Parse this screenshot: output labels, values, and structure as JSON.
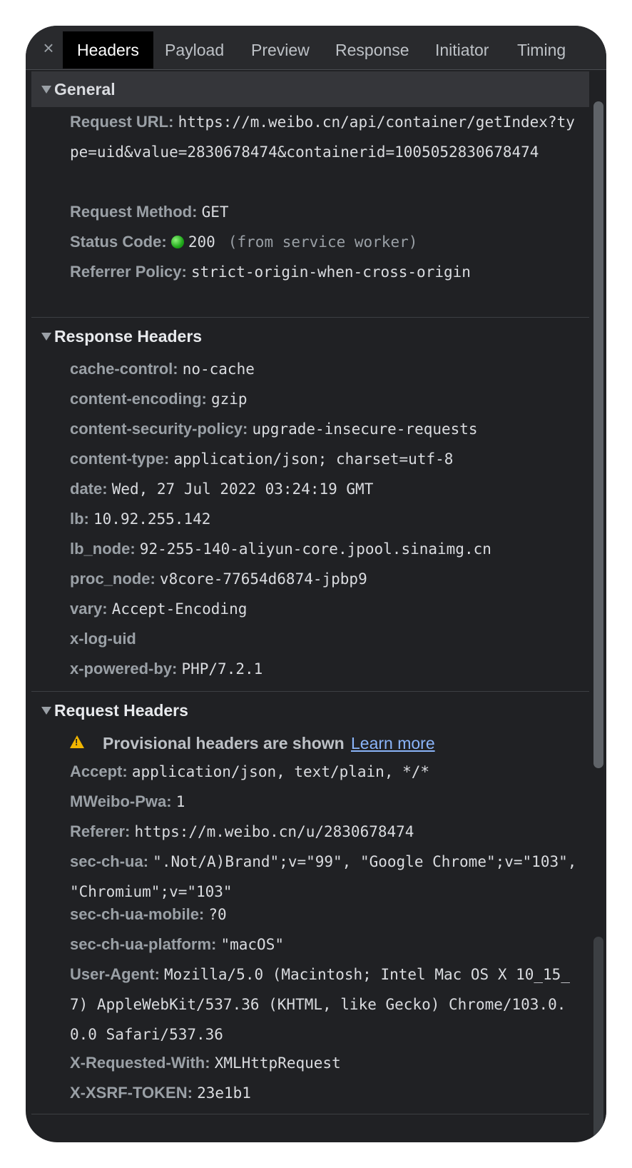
{
  "tabs": {
    "close_label": "×",
    "items": [
      "Headers",
      "Payload",
      "Preview",
      "Response",
      "Initiator",
      "Timing"
    ]
  },
  "general": {
    "title": "General",
    "request_url_name": "Request URL:",
    "request_url_value": "https://m.weibo.cn/api/container/getIndex?type=uid&value=2830678474&containerid=1005052830678474",
    "request_method_name": "Request Method:",
    "request_method_value": "GET",
    "status_code_name": "Status Code:",
    "status_code_value": "200",
    "status_code_note": "(from service worker)",
    "referrer_policy_name": "Referrer Policy:",
    "referrer_policy_value": "strict-origin-when-cross-origin"
  },
  "response_headers": {
    "title": "Response Headers",
    "items": [
      {
        "name": "cache-control:",
        "value": "no-cache"
      },
      {
        "name": "content-encoding:",
        "value": "gzip"
      },
      {
        "name": "content-security-policy:",
        "value": "upgrade-insecure-requests"
      },
      {
        "name": "content-type:",
        "value": "application/json; charset=utf-8"
      },
      {
        "name": "date:",
        "value": "Wed, 27 Jul 2022 03:24:19 GMT"
      },
      {
        "name": "lb:",
        "value": "10.92.255.142"
      },
      {
        "name": "lb_node:",
        "value": "92-255-140-aliyun-core.jpool.sinaimg.cn"
      },
      {
        "name": "proc_node:",
        "value": "v8core-77654d6874-jpbp9"
      },
      {
        "name": "vary:",
        "value": "Accept-Encoding"
      },
      {
        "name": "x-log-uid",
        "value": ""
      },
      {
        "name": "x-powered-by:",
        "value": "PHP/7.2.1"
      }
    ]
  },
  "request_headers": {
    "title": "Request Headers",
    "warning_text": "Provisional headers are shown",
    "learn_more": "Learn more",
    "items": [
      {
        "name": "Accept:",
        "value": "application/json, text/plain, */*"
      },
      {
        "name": "MWeibo-Pwa:",
        "value": "1"
      },
      {
        "name": "Referer:",
        "value": "https://m.weibo.cn/u/2830678474"
      },
      {
        "name": "sec-ch-ua:",
        "value": "\".Not/A)Brand\";v=\"99\", \"Google Chrome\";v=\"103\", \"Chromium\";v=\"103\""
      },
      {
        "name": "sec-ch-ua-mobile:",
        "value": "?0"
      },
      {
        "name": "sec-ch-ua-platform:",
        "value": "\"macOS\""
      },
      {
        "name": "User-Agent:",
        "value": "Mozilla/5.0 (Macintosh; Intel Mac OS X 10_15_7) AppleWebKit/537.36 (KHTML, like Gecko) Chrome/103.0.0.0 Safari/537.36"
      },
      {
        "name": "X-Requested-With:",
        "value": "XMLHttpRequest"
      },
      {
        "name": "X-XSRF-TOKEN:",
        "value": "23e1b1"
      }
    ]
  }
}
